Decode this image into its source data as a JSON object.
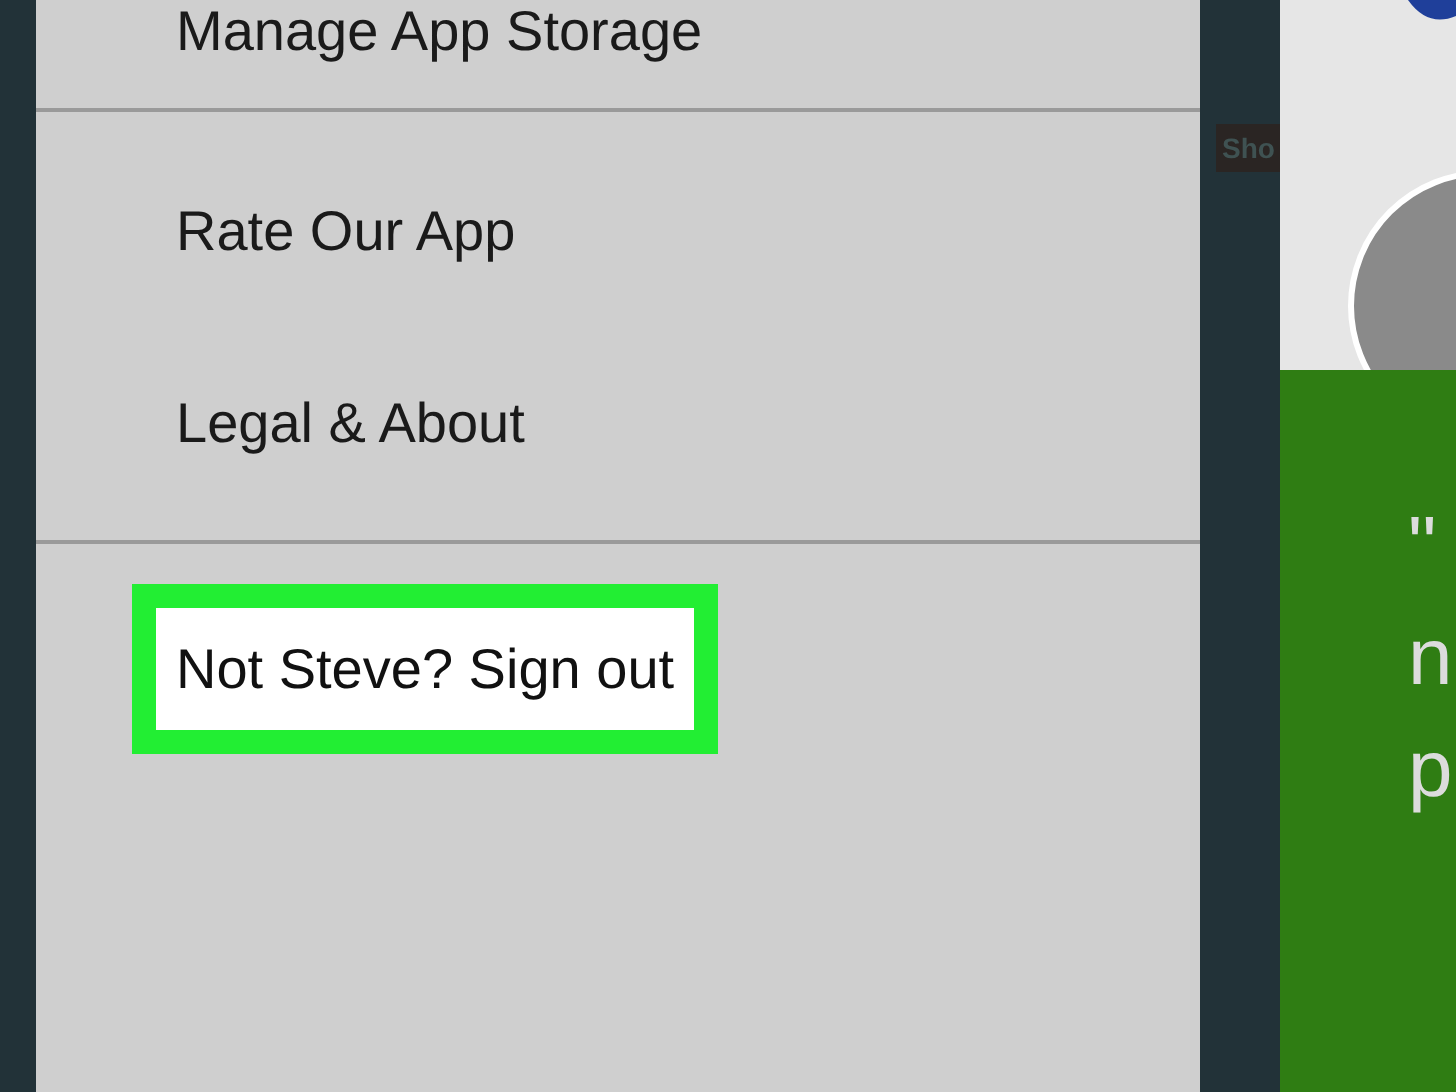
{
  "menu": {
    "sections": [
      {
        "items": [
          "Manage App Storage"
        ]
      },
      {
        "items": [
          "Rate Our App",
          "Legal & About"
        ]
      }
    ],
    "sign_out": {
      "label": "Not Steve? Sign out",
      "highlighted": true
    }
  },
  "background": {
    "tag": "Sho"
  },
  "side_panel": {
    "fragments": [
      "\"",
      "n",
      "p"
    ]
  }
}
